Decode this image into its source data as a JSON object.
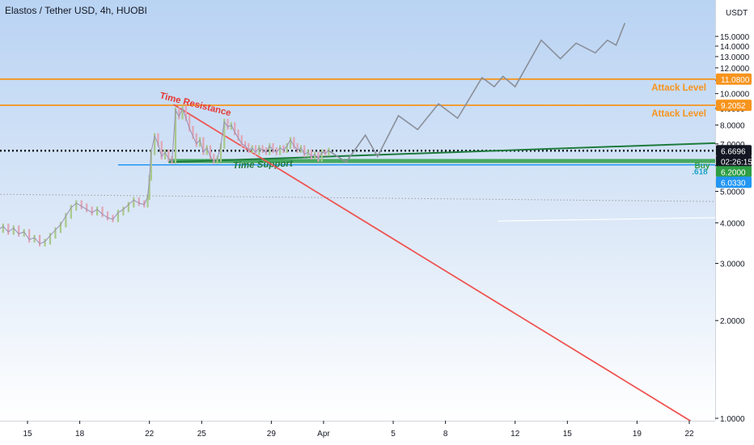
{
  "header": {
    "title": "Elastos / Tether USD, 4h, HUOBI"
  },
  "chart_data": {
    "type": "line",
    "title": "Elastos / Tether USD, 4h, HUOBI",
    "ylabel": "USDT",
    "ylim": [
      0.85,
      16.2
    ],
    "y_scale": "log",
    "x_tick_labels": [
      {
        "label": "15",
        "day": 15
      },
      {
        "label": "18",
        "day": 18
      },
      {
        "label": "22",
        "day": 22
      },
      {
        "label": "25",
        "day": 25
      },
      {
        "label": "29",
        "day": 29
      },
      {
        "label": "Apr",
        "day": 32
      },
      {
        "label": "5",
        "day": 36
      },
      {
        "label": "8",
        "day": 39
      },
      {
        "label": "12",
        "day": 43
      },
      {
        "label": "15",
        "day": 46
      },
      {
        "label": "19",
        "day": 50
      },
      {
        "label": "22",
        "day": 53
      }
    ],
    "y_ticks": [
      1,
      2,
      3,
      4,
      5,
      6,
      7,
      8,
      9,
      10,
      11,
      12,
      13,
      14,
      15
    ],
    "y_tick_labels": [
      "1.0000",
      "2.0000",
      "3.0000",
      "4.0000",
      "5.0000",
      "6.0000",
      "7.0000",
      "8.0000",
      "9.0000",
      "10.0000",
      "11.0000",
      "12.0000",
      "13.0000",
      "14.0000",
      "15.0000"
    ],
    "price_badges": [
      {
        "label": "11.0800",
        "value": 11.08,
        "color": "#f7941d"
      },
      {
        "label": "9.2052",
        "value": 9.2052,
        "color": "#f7941d"
      },
      {
        "label": "6.6696",
        "value": 6.6696,
        "color": "#131722"
      },
      {
        "label": "02:26:15",
        "value": 6.38,
        "color": "#131722"
      },
      {
        "label": "6.2000",
        "value": 6.2,
        "color": "#2e9e44"
      },
      {
        "label": "6.0330",
        "value": 6.033,
        "color": "#2196f3"
      }
    ],
    "price_close": [
      [
        12.7,
        3.85
      ],
      [
        13,
        3.9
      ],
      [
        13.3,
        3.8
      ],
      [
        13.6,
        3.9
      ],
      [
        13.9,
        3.75
      ],
      [
        14.2,
        3.85
      ],
      [
        14.5,
        3.7
      ],
      [
        14.8,
        3.75
      ],
      [
        15.1,
        3.55
      ],
      [
        15.4,
        3.6
      ],
      [
        15.7,
        3.45
      ],
      [
        16.0,
        3.5
      ],
      [
        16.3,
        3.65
      ],
      [
        16.6,
        3.8
      ],
      [
        16.9,
        3.95
      ],
      [
        17.2,
        4.2
      ],
      [
        17.5,
        4.45
      ],
      [
        17.8,
        4.6
      ],
      [
        18.1,
        4.5
      ],
      [
        18.4,
        4.4
      ],
      [
        18.7,
        4.3
      ],
      [
        19.0,
        4.4
      ],
      [
        19.3,
        4.25
      ],
      [
        19.6,
        4.15
      ],
      [
        19.9,
        4.1
      ],
      [
        20.2,
        4.3
      ],
      [
        20.5,
        4.4
      ],
      [
        20.8,
        4.55
      ],
      [
        21.1,
        4.7
      ],
      [
        21.4,
        4.6
      ],
      [
        21.7,
        4.55
      ],
      [
        21.9,
        4.8
      ],
      [
        22.0,
        5.5
      ],
      [
        22.1,
        6.6
      ],
      [
        22.3,
        7.4
      ],
      [
        22.5,
        7.0
      ],
      [
        22.7,
        6.4
      ],
      [
        22.9,
        6.6
      ],
      [
        23.1,
        6.3
      ],
      [
        23.3,
        6.2
      ],
      [
        23.5,
        8.9
      ],
      [
        23.7,
        8.5
      ],
      [
        23.9,
        9.0
      ],
      [
        24.1,
        8.4
      ],
      [
        24.3,
        7.8
      ],
      [
        24.5,
        7.4
      ],
      [
        24.7,
        7.0
      ],
      [
        24.9,
        7.2
      ],
      [
        25.1,
        6.6
      ],
      [
        25.3,
        6.8
      ],
      [
        25.5,
        6.4
      ],
      [
        25.7,
        6.2
      ],
      [
        25.9,
        6.3
      ],
      [
        26.1,
        6.9
      ],
      [
        26.3,
        8.2
      ],
      [
        26.5,
        7.9
      ],
      [
        26.7,
        8.0
      ],
      [
        26.9,
        7.6
      ],
      [
        27.1,
        7.3
      ],
      [
        27.3,
        7.0
      ],
      [
        27.5,
        6.9
      ],
      [
        27.7,
        6.7
      ],
      [
        27.9,
        6.8
      ],
      [
        28.1,
        6.6
      ],
      [
        28.3,
        6.8
      ],
      [
        28.5,
        6.7
      ],
      [
        28.7,
        6.6
      ],
      [
        28.9,
        6.9
      ],
      [
        29.1,
        6.7
      ],
      [
        29.3,
        6.6
      ],
      [
        29.5,
        6.8
      ],
      [
        29.7,
        6.7
      ],
      [
        29.9,
        6.9
      ],
      [
        30.1,
        7.2
      ],
      [
        30.3,
        6.9
      ],
      [
        30.5,
        6.7
      ],
      [
        30.7,
        6.8
      ],
      [
        30.9,
        6.5
      ],
      [
        31.1,
        6.6
      ],
      [
        31.3,
        6.4
      ],
      [
        31.5,
        6.5
      ],
      [
        31.7,
        6.3
      ],
      [
        31.9,
        6.6
      ],
      [
        32.1,
        6.55
      ],
      [
        32.3,
        6.67
      ]
    ],
    "projection": [
      [
        32.3,
        6.67
      ],
      [
        33.3,
        6.15
      ],
      [
        34.4,
        7.45
      ],
      [
        35.1,
        6.4
      ],
      [
        36.3,
        8.55
      ],
      [
        37.4,
        7.75
      ],
      [
        38.6,
        9.3
      ],
      [
        39.7,
        8.4
      ],
      [
        41.1,
        11.2
      ],
      [
        41.8,
        10.5
      ],
      [
        42.3,
        11.3
      ],
      [
        43.0,
        10.5
      ],
      [
        44.5,
        14.6
      ],
      [
        45.6,
        12.8
      ],
      [
        46.5,
        14.3
      ],
      [
        47.6,
        13.35
      ],
      [
        48.3,
        14.6
      ],
      [
        48.8,
        14.1
      ],
      [
        49.3,
        16.5
      ]
    ],
    "attack_levels": [
      {
        "value": 11.08,
        "label": "Attack Level",
        "color": "#f7941d"
      },
      {
        "value": 9.2052,
        "label": "Attack Level",
        "color": "#f7941d"
      }
    ],
    "time_resistance": {
      "label": "Time Resistance",
      "from": [
        23.4,
        9.25
      ],
      "to": [
        53.5,
        0.95
      ],
      "color": "#ef5350"
    },
    "time_support": {
      "label": "Time Support",
      "from": [
        23.1,
        6.15
      ],
      "to": [
        54.8,
        7.05
      ],
      "color": "#1e7a3c"
    },
    "support_green": {
      "value": 6.2,
      "from_day": 23.1,
      "label": "Buy",
      "color": "#2e9e44"
    },
    "fib_line": {
      "value": 6.033,
      "from_day": 20.2,
      "label": ".618",
      "color": "#2196f3"
    },
    "current_price_line": {
      "value": 6.6696,
      "color": "#131722"
    },
    "dotted_gray_line": {
      "from": [
        12.7,
        4.9
      ],
      "to": [
        54.8,
        4.65
      ]
    }
  }
}
